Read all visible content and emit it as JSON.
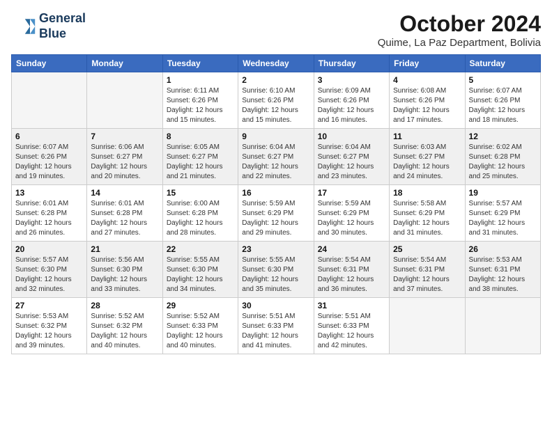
{
  "logo": {
    "line1": "General",
    "line2": "Blue"
  },
  "title": "October 2024",
  "location": "Quime, La Paz Department, Bolivia",
  "days_of_week": [
    "Sunday",
    "Monday",
    "Tuesday",
    "Wednesday",
    "Thursday",
    "Friday",
    "Saturday"
  ],
  "weeks": [
    [
      {
        "num": "",
        "empty": true
      },
      {
        "num": "",
        "empty": true
      },
      {
        "num": "1",
        "sunrise": "6:11 AM",
        "sunset": "6:26 PM",
        "daylight": "12 hours and 15 minutes."
      },
      {
        "num": "2",
        "sunrise": "6:10 AM",
        "sunset": "6:26 PM",
        "daylight": "12 hours and 15 minutes."
      },
      {
        "num": "3",
        "sunrise": "6:09 AM",
        "sunset": "6:26 PM",
        "daylight": "12 hours and 16 minutes."
      },
      {
        "num": "4",
        "sunrise": "6:08 AM",
        "sunset": "6:26 PM",
        "daylight": "12 hours and 17 minutes."
      },
      {
        "num": "5",
        "sunrise": "6:07 AM",
        "sunset": "6:26 PM",
        "daylight": "12 hours and 18 minutes."
      }
    ],
    [
      {
        "num": "6",
        "sunrise": "6:07 AM",
        "sunset": "6:26 PM",
        "daylight": "12 hours and 19 minutes."
      },
      {
        "num": "7",
        "sunrise": "6:06 AM",
        "sunset": "6:27 PM",
        "daylight": "12 hours and 20 minutes."
      },
      {
        "num": "8",
        "sunrise": "6:05 AM",
        "sunset": "6:27 PM",
        "daylight": "12 hours and 21 minutes."
      },
      {
        "num": "9",
        "sunrise": "6:04 AM",
        "sunset": "6:27 PM",
        "daylight": "12 hours and 22 minutes."
      },
      {
        "num": "10",
        "sunrise": "6:04 AM",
        "sunset": "6:27 PM",
        "daylight": "12 hours and 23 minutes."
      },
      {
        "num": "11",
        "sunrise": "6:03 AM",
        "sunset": "6:27 PM",
        "daylight": "12 hours and 24 minutes."
      },
      {
        "num": "12",
        "sunrise": "6:02 AM",
        "sunset": "6:28 PM",
        "daylight": "12 hours and 25 minutes."
      }
    ],
    [
      {
        "num": "13",
        "sunrise": "6:01 AM",
        "sunset": "6:28 PM",
        "daylight": "12 hours and 26 minutes."
      },
      {
        "num": "14",
        "sunrise": "6:01 AM",
        "sunset": "6:28 PM",
        "daylight": "12 hours and 27 minutes."
      },
      {
        "num": "15",
        "sunrise": "6:00 AM",
        "sunset": "6:28 PM",
        "daylight": "12 hours and 28 minutes."
      },
      {
        "num": "16",
        "sunrise": "5:59 AM",
        "sunset": "6:29 PM",
        "daylight": "12 hours and 29 minutes."
      },
      {
        "num": "17",
        "sunrise": "5:59 AM",
        "sunset": "6:29 PM",
        "daylight": "12 hours and 30 minutes."
      },
      {
        "num": "18",
        "sunrise": "5:58 AM",
        "sunset": "6:29 PM",
        "daylight": "12 hours and 31 minutes."
      },
      {
        "num": "19",
        "sunrise": "5:57 AM",
        "sunset": "6:29 PM",
        "daylight": "12 hours and 31 minutes."
      }
    ],
    [
      {
        "num": "20",
        "sunrise": "5:57 AM",
        "sunset": "6:30 PM",
        "daylight": "12 hours and 32 minutes."
      },
      {
        "num": "21",
        "sunrise": "5:56 AM",
        "sunset": "6:30 PM",
        "daylight": "12 hours and 33 minutes."
      },
      {
        "num": "22",
        "sunrise": "5:55 AM",
        "sunset": "6:30 PM",
        "daylight": "12 hours and 34 minutes."
      },
      {
        "num": "23",
        "sunrise": "5:55 AM",
        "sunset": "6:30 PM",
        "daylight": "12 hours and 35 minutes."
      },
      {
        "num": "24",
        "sunrise": "5:54 AM",
        "sunset": "6:31 PM",
        "daylight": "12 hours and 36 minutes."
      },
      {
        "num": "25",
        "sunrise": "5:54 AM",
        "sunset": "6:31 PM",
        "daylight": "12 hours and 37 minutes."
      },
      {
        "num": "26",
        "sunrise": "5:53 AM",
        "sunset": "6:31 PM",
        "daylight": "12 hours and 38 minutes."
      }
    ],
    [
      {
        "num": "27",
        "sunrise": "5:53 AM",
        "sunset": "6:32 PM",
        "daylight": "12 hours and 39 minutes."
      },
      {
        "num": "28",
        "sunrise": "5:52 AM",
        "sunset": "6:32 PM",
        "daylight": "12 hours and 40 minutes."
      },
      {
        "num": "29",
        "sunrise": "5:52 AM",
        "sunset": "6:33 PM",
        "daylight": "12 hours and 40 minutes."
      },
      {
        "num": "30",
        "sunrise": "5:51 AM",
        "sunset": "6:33 PM",
        "daylight": "12 hours and 41 minutes."
      },
      {
        "num": "31",
        "sunrise": "5:51 AM",
        "sunset": "6:33 PM",
        "daylight": "12 hours and 42 minutes."
      },
      {
        "num": "",
        "empty": true
      },
      {
        "num": "",
        "empty": true
      }
    ]
  ]
}
